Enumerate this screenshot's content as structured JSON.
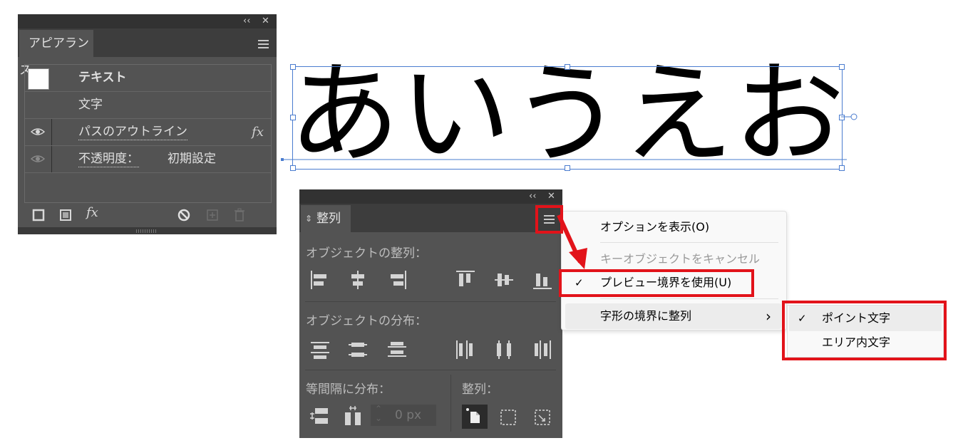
{
  "appearance_panel": {
    "collapse_glyph": "‹‹",
    "close_glyph": "✕",
    "tab_label": "アピアランス",
    "rows": [
      {
        "label": "テキスト"
      },
      {
        "label": "文字"
      },
      {
        "label": "パスのアウトライン",
        "fx": "fx"
      },
      {
        "label": "不透明度：",
        "value": "初期設定"
      }
    ],
    "footer_fx": "fx"
  },
  "canvas_text": {
    "text": "あいうえお"
  },
  "align_panel": {
    "collapse_glyph": "‹‹",
    "close_glyph": "✕",
    "tab_label": "整列",
    "tab_arrows": "⇕",
    "section_align_objects": "オブジェクトの整列：",
    "section_distribute_objects": "オブジェクトの分布：",
    "section_distribute_spacing": "等間隔に分布：",
    "section_align_to": "整列：",
    "spacing_value": "0 px"
  },
  "flyout_menu": {
    "items": [
      {
        "label": "オプションを表示(O)",
        "enabled": true,
        "checked": false
      },
      {
        "label": "キーオブジェクトをキャンセル",
        "enabled": false,
        "checked": false
      },
      {
        "label": "プレビュー境界を使用(U)",
        "enabled": true,
        "checked": true
      },
      {
        "label": "字形の境界に整列",
        "enabled": true,
        "checked": false,
        "submenu": true
      }
    ],
    "check_glyph": "✓",
    "submenu_arrow": "›"
  },
  "submenu": {
    "items": [
      {
        "label": "ポイント文字",
        "checked": true
      },
      {
        "label": "エリア内文字",
        "checked": false
      }
    ]
  },
  "colors": {
    "panel_bg": "#535353",
    "highlight_red": "#e2131a",
    "selection_blue": "#4a7ccf"
  }
}
